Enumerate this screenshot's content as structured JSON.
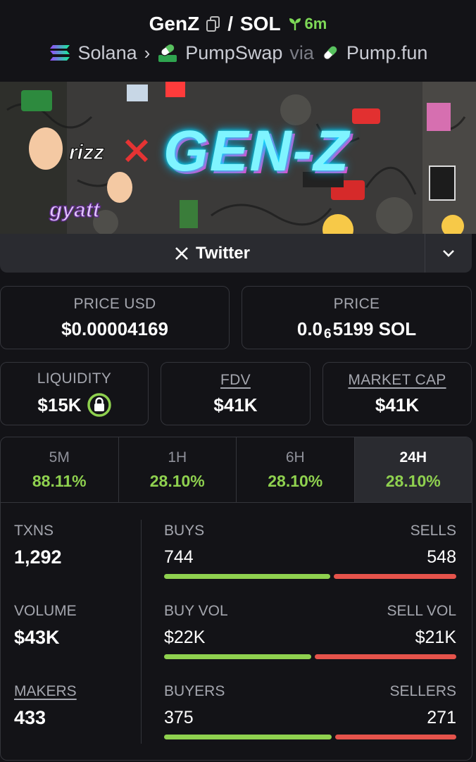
{
  "header": {
    "token": "GenZ",
    "separator": "/",
    "quote": "SOL",
    "age": "6m",
    "chain": "Solana",
    "dex": "PumpSwap",
    "via": "via",
    "launchpad": "Pump.fun",
    "banner_text": "GEN-Z"
  },
  "links": {
    "twitter": "Twitter"
  },
  "price": {
    "usd_label": "PRICE USD",
    "usd_value": "$0.00004169",
    "native_label": "PRICE",
    "native_prefix": "0.0",
    "native_zeros": "6",
    "native_suffix": "5199 SOL"
  },
  "metrics": {
    "liquidity_label": "LIQUIDITY",
    "liquidity_value": "$15K",
    "fdv_label": "FDV",
    "fdv_value": "$41K",
    "mcap_label": "MARKET CAP",
    "mcap_value": "$41K"
  },
  "periods": [
    {
      "label": "5M",
      "change": "88.11%"
    },
    {
      "label": "1H",
      "change": "28.10%"
    },
    {
      "label": "6H",
      "change": "28.10%"
    },
    {
      "label": "24H",
      "change": "28.10%"
    }
  ],
  "active_period": "24H",
  "stats": {
    "txns_label": "TXNS",
    "txns_value": "1,292",
    "buys_label": "BUYS",
    "buys_value": "744",
    "sells_label": "SELLS",
    "sells_value": "548",
    "volume_label": "VOLUME",
    "volume_value": "$43K",
    "buy_vol_label": "BUY VOL",
    "buy_vol_value": "$22K",
    "sell_vol_label": "SELL VOL",
    "sell_vol_value": "$21K",
    "makers_label": "MAKERS",
    "makers_value": "433",
    "buyers_label": "BUYERS",
    "buyers_value": "375",
    "sellers_label": "SELLERS",
    "sellers_value": "271",
    "buy_share": 0.576,
    "buy_vol_share": 0.51,
    "buyers_share": 0.58
  },
  "colors": {
    "positive": "#8fd14f",
    "negative": "#e5534b",
    "background": "#131317",
    "panel": "#2a2b30"
  }
}
